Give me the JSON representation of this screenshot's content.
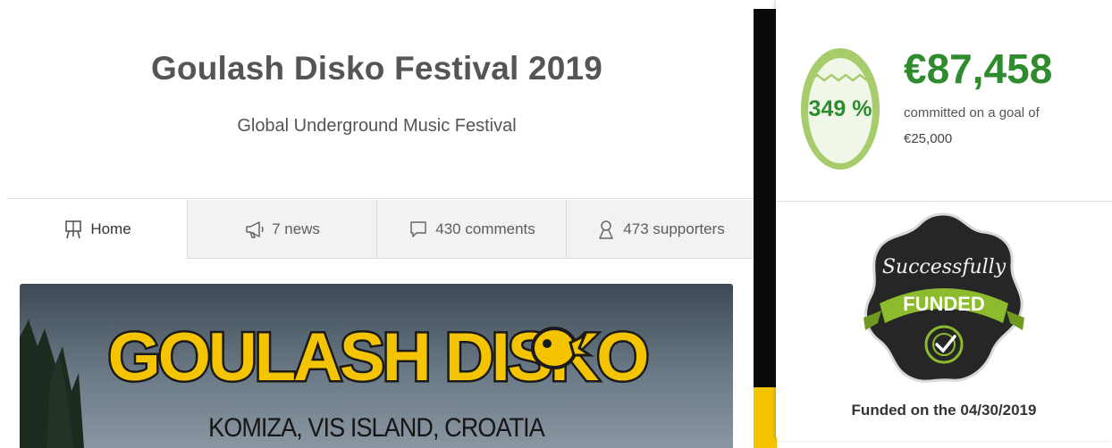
{
  "project": {
    "title": "Goulash Disko Festival 2019",
    "subtitle": "Global Underground Music Festival"
  },
  "tabs": [
    {
      "label": "Home",
      "icon": "easel-icon"
    },
    {
      "label": "7 news",
      "icon": "megaphone-icon"
    },
    {
      "label": "430 comments",
      "icon": "speech-bubble-icon"
    },
    {
      "label": "473 supporters",
      "icon": "person-icon"
    }
  ],
  "banner": {
    "logo_text": "GOULASH DISKO",
    "location": "KOMIZA, VIS ISLAND, CROATIA"
  },
  "funding": {
    "percent": "349 %",
    "amount": "€87,458",
    "committed_label": "committed on a goal of",
    "goal": "€25,000",
    "badge_top": "Successfully",
    "badge_ribbon": "FUNDED",
    "funded_on": "Funded on the 04/30/2019"
  },
  "colors": {
    "accent_green": "#2e8b2e",
    "egg_green": "#a6cc6b",
    "badge_ribbon": "#8dbb2e",
    "logo_yellow": "#f5c400"
  }
}
